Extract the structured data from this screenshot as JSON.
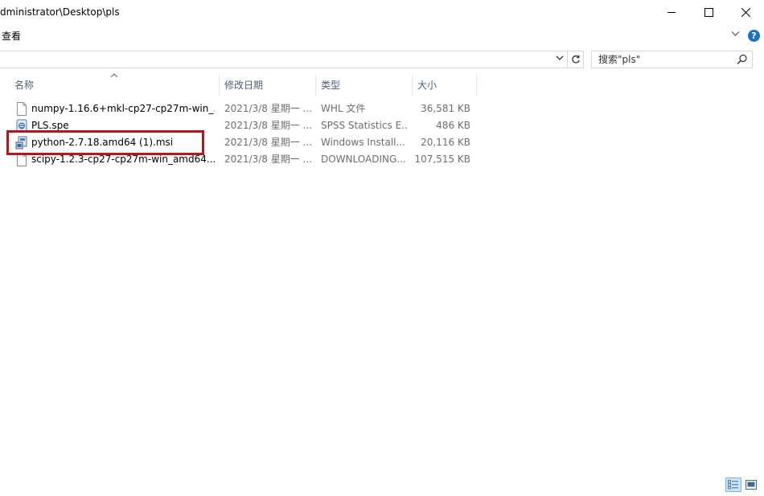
{
  "titlebar": {
    "path": "dministrator\\Desktop\\pls"
  },
  "ribbon": {
    "view_tab": "查看"
  },
  "search": {
    "placeholder": "搜索\"pls\""
  },
  "columns": {
    "name": "名称",
    "date": "修改日期",
    "type": "类型",
    "size": "大小"
  },
  "files": [
    {
      "name": "numpy-1.16.6+mkl-cp27-cp27m-win_...",
      "date": "2021/3/8 星期一 ...",
      "type": "WHL 文件",
      "size": "36,581 KB",
      "icon": "blank-file-icon"
    },
    {
      "name": "PLS.spe",
      "date": "2021/3/8 星期一 ...",
      "type": "SPSS Statistics E...",
      "size": "486 KB",
      "icon": "spss-extension-icon"
    },
    {
      "name": "python-2.7.18.amd64 (1).msi",
      "date": "2021/3/8 星期一 ...",
      "type": "Windows Install...",
      "size": "20,116 KB",
      "icon": "msi-installer-icon"
    },
    {
      "name": "scipy-1.2.3-cp27-cp27m-win_amd64....",
      "date": "2021/3/8 星期一 ...",
      "type": "DOWNLOADING...",
      "size": "107,515 KB",
      "icon": "blank-file-icon"
    }
  ],
  "colors": {
    "highlight": "#b0181c",
    "header_text": "#4c607a",
    "help_icon": "#1a73c8"
  }
}
